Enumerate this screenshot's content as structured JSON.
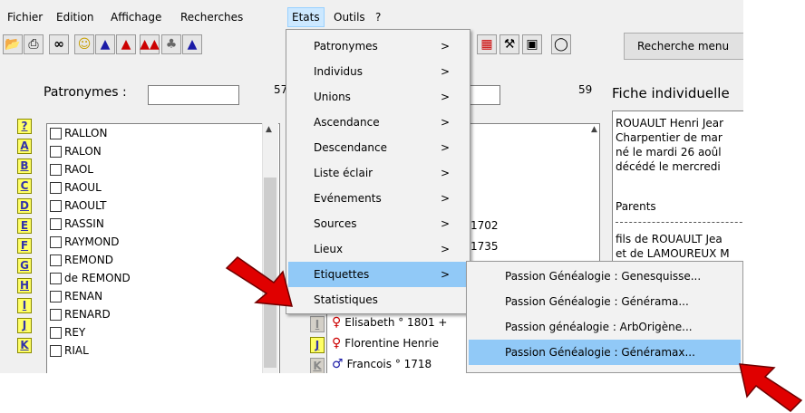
{
  "menubar": [
    "Fichier",
    "Edition",
    "Affichage",
    "Recherches",
    "Etats",
    "Outils",
    "?"
  ],
  "toolbar": {
    "icons": [
      "open-folder-icon",
      "printer-icon",
      "binoculars-icon",
      "smiley-icon",
      "man-icon",
      "woman-icon",
      "couple-icon",
      "family-tree-icon",
      "people-icon"
    ],
    "right_icons": [
      "calendar-icon",
      "tools-icon",
      "save-icon",
      "lightbulb-icon"
    ],
    "search_menu_label": "Recherche menu"
  },
  "patronymes": {
    "label": "Patronymes :",
    "input_value": "",
    "count": "57",
    "letters": [
      "?",
      "A",
      "B",
      "C",
      "D",
      "E",
      "F",
      "G",
      "H",
      "I",
      "J",
      "K"
    ],
    "surnames": [
      "RALLON",
      "RALON",
      "RAOL",
      "RAOUL",
      "RAOULT",
      "RASSIN",
      "RAYMOND",
      "REMOND",
      "de REMOND",
      "RENAN",
      "RENARD",
      "REY",
      "RIAL"
    ]
  },
  "individus": {
    "input_value": "",
    "count": "59",
    "years": [
      "1702",
      "1735"
    ],
    "letters": [
      "I",
      "J",
      "K"
    ],
    "persons": [
      {
        "sex": "F",
        "text": "Elisabeth ° 1801 +"
      },
      {
        "sex": "F",
        "text": "Florentine Henrie"
      },
      {
        "sex": "M",
        "text": "Francois ° 1718"
      }
    ]
  },
  "fiche": {
    "title": "Fiche individuelle",
    "lines": [
      "ROUAULT Henri Jear",
      "Charpentier de mar",
      "né le mardi 26 aoûl",
      "décédé le mercredi"
    ],
    "parents_label": "Parents",
    "parents_lines": [
      "fils de ROUAULT Jea",
      "et de LAMOUREUX M"
    ]
  },
  "etats_menu": [
    {
      "label": "Patronymes",
      "arrow": ">"
    },
    {
      "label": "Individus",
      "arrow": ">"
    },
    {
      "label": "Unions",
      "arrow": ">"
    },
    {
      "label": "Ascendance",
      "arrow": ">"
    },
    {
      "label": "Descendance",
      "arrow": ">"
    },
    {
      "label": "Liste éclair",
      "arrow": ">"
    },
    {
      "label": "Evénements",
      "arrow": ">"
    },
    {
      "label": "Sources",
      "arrow": ">"
    },
    {
      "label": "Lieux",
      "arrow": ">"
    },
    {
      "label": "Etiquettes",
      "arrow": ">"
    },
    {
      "label": "Statistiques",
      "arrow": ""
    }
  ],
  "etiquettes_submenu": [
    "Passion Généalogie : Genesquisse...",
    "Passion Généalogie : Générama...",
    "Passion généalogie : ArbOrigène...",
    "Passion Généalogie : Généramax..."
  ],
  "colors": {
    "menu_highlight": "#91c9f7",
    "letter_tab": "#ffff66",
    "arrow_red": "#e00000",
    "female": "#cc0000",
    "male": "#1a1aa6"
  }
}
